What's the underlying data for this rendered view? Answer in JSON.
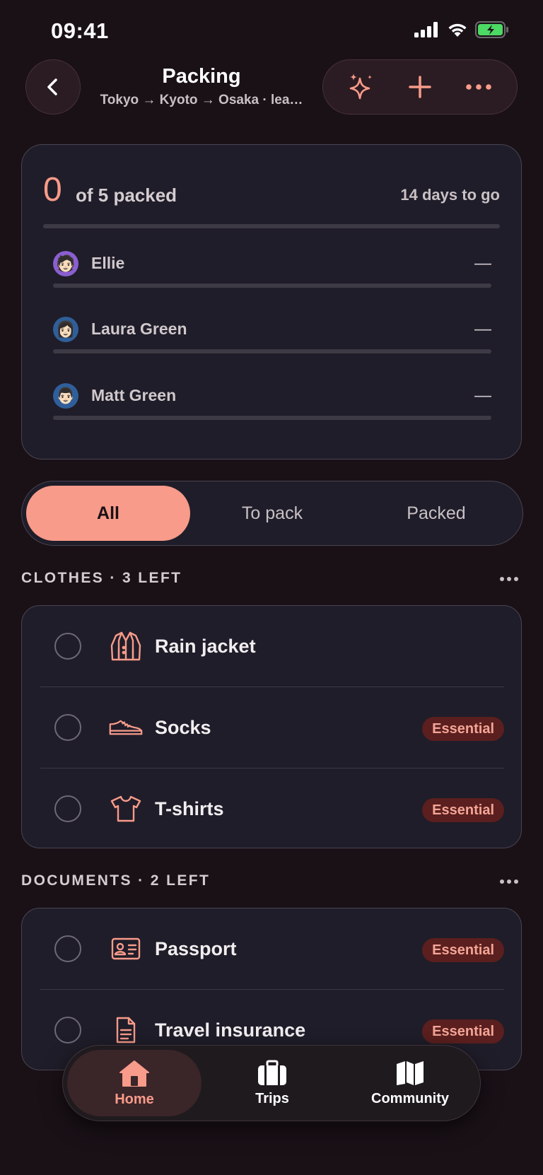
{
  "status_bar": {
    "time": "09:41"
  },
  "header": {
    "title": "Packing",
    "subtitle": "Tokyo → Kyoto → Osaka · lea…",
    "back_icon": "chevron-left-icon",
    "actions": [
      "sparkles-icon",
      "plus-icon",
      "more-horizontal-icon"
    ]
  },
  "summary": {
    "packed_count": "0",
    "count_text": "of 5 packed",
    "days_to_go": "14 days to go",
    "overall_progress": 0,
    "travelers": [
      {
        "name": "Ellie",
        "status": "—",
        "avatar": "🧑🏻",
        "avatar_bg": "#8a5fd0",
        "progress": 0
      },
      {
        "name": "Laura Green",
        "status": "—",
        "avatar": "👩🏻",
        "avatar_bg": "#2f5f9a",
        "progress": 0
      },
      {
        "name": "Matt Green",
        "status": "—",
        "avatar": "👨🏻",
        "avatar_bg": "#2f5f9a",
        "progress": 0
      }
    ]
  },
  "filter": {
    "options": [
      "All",
      "To pack",
      "Packed"
    ],
    "selected": "All"
  },
  "sections": [
    {
      "title": "CLOTHES · 3 LEFT",
      "items": [
        {
          "name": "Rain jacket",
          "icon": "jacket-icon",
          "badge": ""
        },
        {
          "name": "Socks",
          "icon": "shoe-icon",
          "badge": "Essential"
        },
        {
          "name": "T-shirts",
          "icon": "tshirt-icon",
          "badge": "Essential"
        }
      ]
    },
    {
      "title": "DOCUMENTS · 2 LEFT",
      "items": [
        {
          "name": "Passport",
          "icon": "id-card-icon",
          "badge": "Essential"
        },
        {
          "name": "Travel insurance",
          "icon": "document-icon",
          "badge": "Essential"
        }
      ]
    }
  ],
  "tabbar": [
    {
      "label": "Home",
      "icon": "home-icon",
      "active": true
    },
    {
      "label": "Trips",
      "icon": "suitcase-icon",
      "active": false
    },
    {
      "label": "Community",
      "icon": "map-icon",
      "active": false
    }
  ],
  "colors": {
    "accent": "#f89b8a",
    "background": "#1a1117",
    "card": "#1f1d29",
    "badge_bg": "#5a1f1e"
  }
}
